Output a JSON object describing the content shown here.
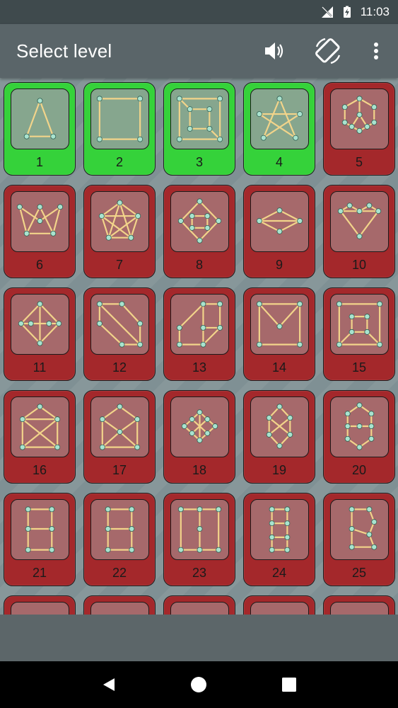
{
  "status_bar": {
    "time": "11:03",
    "icons": [
      "signal-off-icon",
      "battery-charging-icon"
    ]
  },
  "app_bar": {
    "title": "Select level",
    "actions": [
      "volume-icon",
      "screen-rotation-icon",
      "more-vert-icon"
    ]
  },
  "colors": {
    "completed_tile": "#35d23a",
    "locked_tile": "#a4282b",
    "app_bar": "#5a6569",
    "background": "#7f9094"
  },
  "levels": [
    {
      "label": "1",
      "status": "completed"
    },
    {
      "label": "2",
      "status": "completed"
    },
    {
      "label": "3",
      "status": "completed"
    },
    {
      "label": "4",
      "status": "completed"
    },
    {
      "label": "5",
      "status": "locked"
    },
    {
      "label": "6",
      "status": "locked"
    },
    {
      "label": "7",
      "status": "locked"
    },
    {
      "label": "8",
      "status": "locked"
    },
    {
      "label": "9",
      "status": "locked"
    },
    {
      "label": "10",
      "status": "locked"
    },
    {
      "label": "11",
      "status": "locked"
    },
    {
      "label": "12",
      "status": "locked"
    },
    {
      "label": "13",
      "status": "locked"
    },
    {
      "label": "14",
      "status": "locked"
    },
    {
      "label": "15",
      "status": "locked"
    },
    {
      "label": "16",
      "status": "locked"
    },
    {
      "label": "17",
      "status": "locked"
    },
    {
      "label": "18",
      "status": "locked"
    },
    {
      "label": "19",
      "status": "locked"
    },
    {
      "label": "20",
      "status": "locked"
    },
    {
      "label": "21",
      "status": "locked"
    },
    {
      "label": "22",
      "status": "locked"
    },
    {
      "label": "23",
      "status": "locked"
    },
    {
      "label": "24",
      "status": "locked"
    },
    {
      "label": "25",
      "status": "locked"
    }
  ],
  "nav_bar": [
    "back-icon",
    "home-icon",
    "recents-icon"
  ]
}
